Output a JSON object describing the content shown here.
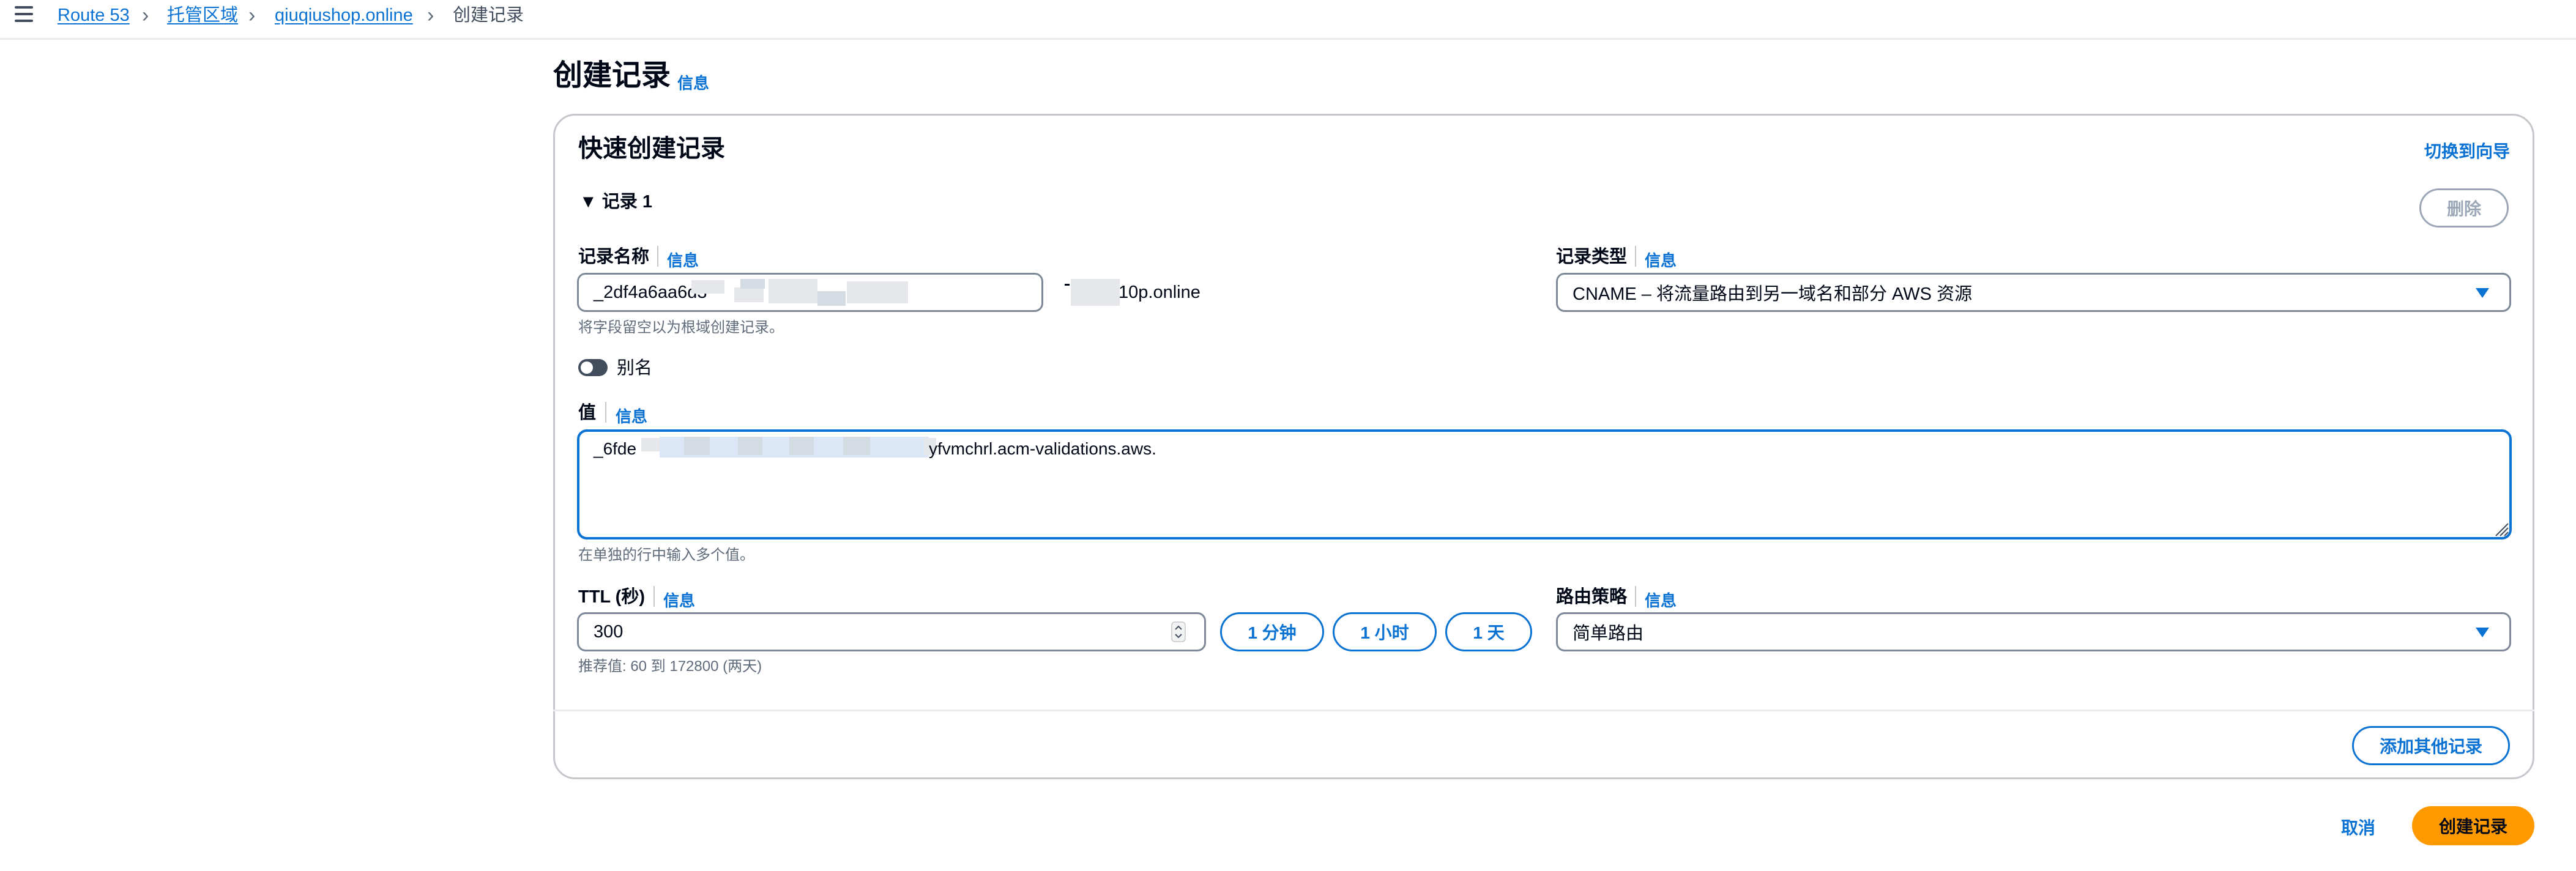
{
  "breadcrumb": {
    "items": [
      "Route 53",
      "托管区域",
      "qiuqiushop.online",
      "创建记录"
    ]
  },
  "page": {
    "title": "创建记录",
    "info": "信息"
  },
  "panel": {
    "title": "快速创建记录",
    "switch_wizard": "切换到向导",
    "record_label": "▼ 记录 1",
    "delete_label": "删除"
  },
  "record_name": {
    "label": "记录名称",
    "info": "信息",
    "value_prefix": "_2df4a6aa6d3",
    "domain_suffix_visible": "10p.online",
    "hint": "将字段留空以为根域创建记录。"
  },
  "record_type": {
    "label": "记录类型",
    "info": "信息",
    "value": "CNAME – 将流量路由到另一域名和部分 AWS 资源"
  },
  "alias": {
    "label": "别名"
  },
  "value_field": {
    "label": "值",
    "info": "信息",
    "value_prefix": "_6fde",
    "value_suffix": "yfvmchrl.acm-validations.aws.",
    "hint": "在单独的行中输入多个值。"
  },
  "ttl": {
    "label": "TTL (秒)",
    "info": "信息",
    "value": "300",
    "hint": "推荐值: 60 到 172800 (两天)",
    "presets": [
      "1 分钟",
      "1 小时",
      "1 天"
    ]
  },
  "routing_policy": {
    "label": "路由策略",
    "info": "信息",
    "value": "简单路由"
  },
  "footer": {
    "add_record": "添加其他记录",
    "cancel": "取消",
    "create": "创建记录"
  },
  "colors": {
    "link": "#0972d3",
    "primary": "#ff9900",
    "focus_border": "#0972d3"
  }
}
